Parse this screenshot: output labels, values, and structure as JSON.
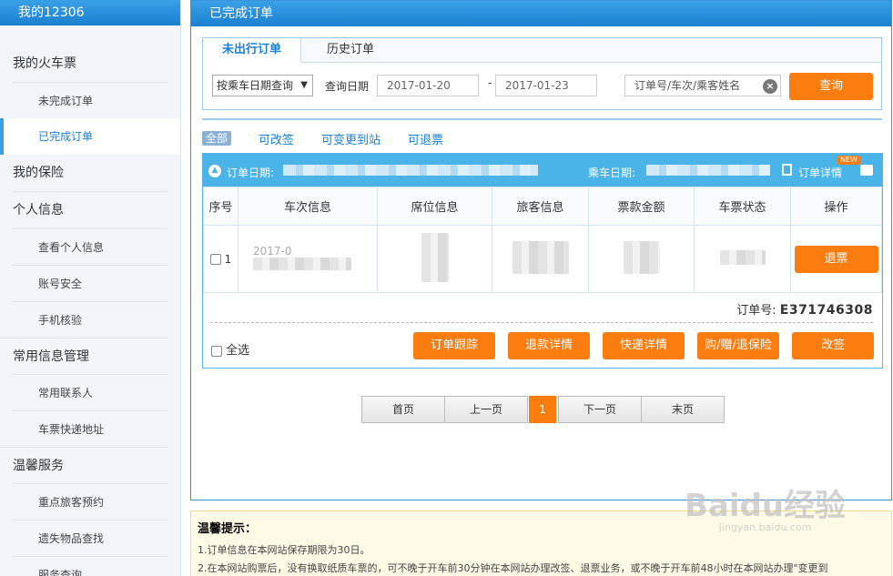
{
  "sidebar": {
    "title": "我的12306",
    "groups": [
      {
        "label": "我的火车票",
        "items": [
          "未完成订单",
          "已完成订单"
        ]
      },
      {
        "label": "我的保险",
        "items": []
      },
      {
        "label": "个人信息",
        "items": [
          "查看个人信息",
          "账号安全",
          "手机核验"
        ]
      },
      {
        "label": "常用信息管理",
        "items": [
          "常用联系人",
          "车票快递地址"
        ]
      },
      {
        "label": "温馨服务",
        "items": [
          "重点旅客预约",
          "遗失物品查找",
          "服务查询"
        ]
      }
    ],
    "active_item": "已完成订单"
  },
  "main": {
    "title": "已完成订单",
    "tabs": [
      "未出行订单",
      "历史订单"
    ],
    "active_tab": "未出行订单",
    "query": {
      "select_value": "按乘车日期查询",
      "date_label": "查询日期",
      "date_from": "2017-01-20",
      "date_sep": "-",
      "date_to": "2017-01-23",
      "keyword_placeholder": "订单号/车次/乘客姓名",
      "button": "查询"
    },
    "filters": [
      "全部",
      "可改签",
      "可变更到站",
      "可退票"
    ],
    "active_filter": "全部",
    "order": {
      "order_date_label": "订单日期:",
      "ride_date_label": "乘车日期:",
      "detail_link": "订单详情",
      "new_badge": "NEW",
      "columns": [
        "序号",
        "车次信息",
        "席位信息",
        "旅客信息",
        "票款金额",
        "车票状态",
        "操作"
      ],
      "row": {
        "index": "1",
        "train_prefix": "2017-0",
        "action": "退票"
      },
      "order_no_label": "订单号:",
      "order_no": "E371746308",
      "select_all": "全选",
      "actions": [
        "订单跟踪",
        "退款详情",
        "快递详情",
        "购/赠/退保险",
        "改签"
      ]
    },
    "pager": {
      "first": "首页",
      "prev": "上一页",
      "current": "1",
      "next": "下一页",
      "last": "末页"
    }
  },
  "tips": {
    "title": "温馨提示：",
    "lines": [
      "1.订单信息在本网站保存期限为30日。",
      "2.在本网站购票后，没有换取纸质车票的，可不晚于开车前30分钟在本网站办理改签、退票业务，或不晚于开车前48小时在本网站办理\"变更到"
    ]
  },
  "watermark": {
    "brand": "Baidu经验",
    "url": "jingyan.baidu.com"
  },
  "colors": {
    "accent": "#1b80cf",
    "header": "#3aa0e6",
    "button": "#fb7d10",
    "order_head": "#4ab4e8"
  }
}
